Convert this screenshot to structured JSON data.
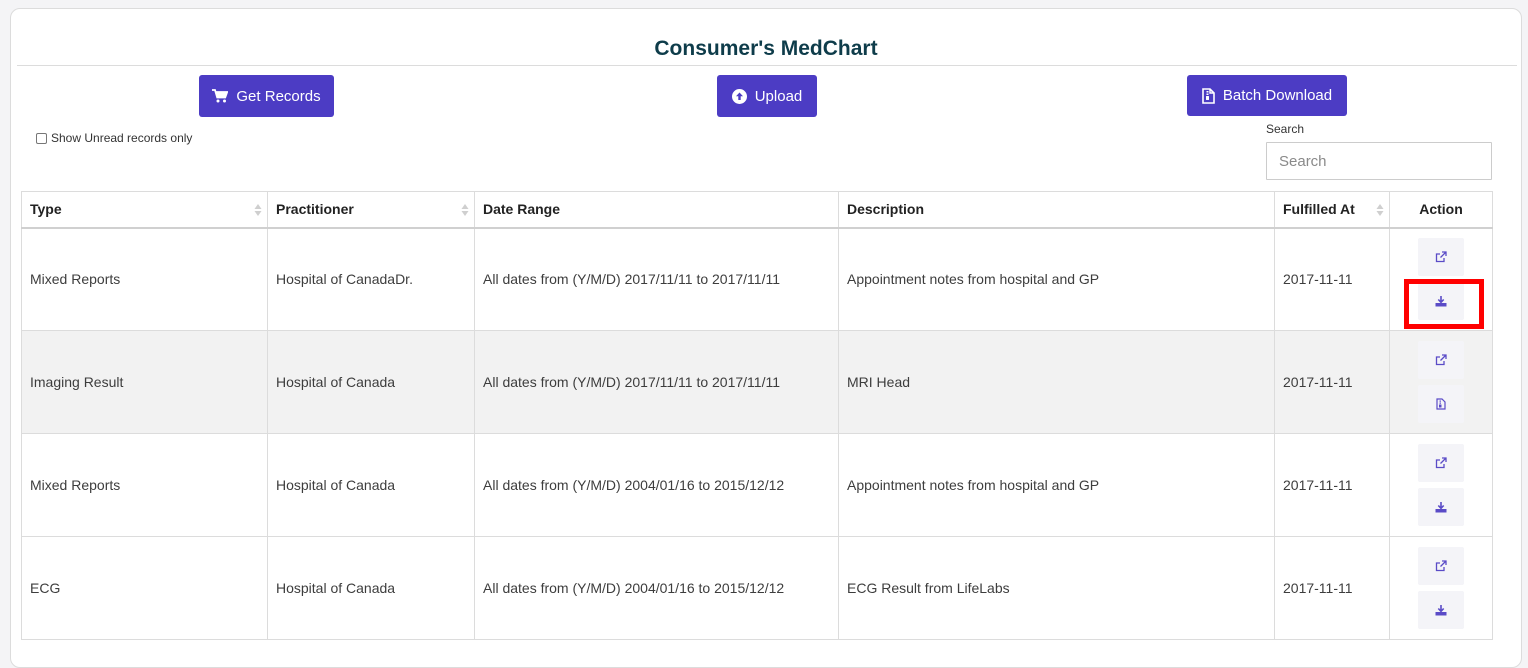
{
  "page": {
    "title": "Consumer's MedChart"
  },
  "toolbar": {
    "get_records": {
      "label": "Get Records",
      "icon": "shopping-cart-icon"
    },
    "upload": {
      "label": "Upload",
      "icon": "arrow-circle-up-icon"
    },
    "batch_download": {
      "label": "Batch Download",
      "icon": "file-zip-icon"
    }
  },
  "filter": {
    "show_unread_label": "Show Unread records only",
    "checked": false
  },
  "search": {
    "label": "Search",
    "placeholder": "Search",
    "value": ""
  },
  "table": {
    "headers": {
      "type": "Type",
      "practitioner": "Practitioner",
      "date_range": "Date Range",
      "description": "Description",
      "fulfilled_at": "Fulfilled At",
      "action": "Action"
    },
    "rows": [
      {
        "type": "Mixed Reports",
        "practitioner": "Hospital of CanadaDr.",
        "date_range": "All dates from (Y/M/D) 2017/11/11 to 2017/11/11",
        "description": "Appointment notes from hospital and GP",
        "fulfilled_at": "2017-11-11",
        "actions": [
          "external-link-icon",
          "download-icon"
        ]
      },
      {
        "type": "Imaging Result",
        "practitioner": "Hospital of Canada",
        "date_range": "All dates from (Y/M/D) 2017/11/11 to 2017/11/11",
        "description": "MRI Head",
        "fulfilled_at": "2017-11-11",
        "actions": [
          "external-link-icon",
          "file-zip-icon"
        ]
      },
      {
        "type": "Mixed Reports",
        "practitioner": "Hospital of Canada",
        "date_range": "All dates from (Y/M/D) 2004/01/16 to 2015/12/12",
        "description": "Appointment notes from hospital and GP",
        "fulfilled_at": "2017-11-11",
        "actions": [
          "external-link-icon",
          "download-icon"
        ]
      },
      {
        "type": "ECG",
        "practitioner": "Hospital of Canada",
        "date_range": "All dates from (Y/M/D) 2004/01/16 to 2015/12/12",
        "description": "ECG Result from LifeLabs",
        "fulfilled_at": "2017-11-11",
        "actions": [
          "external-link-icon",
          "download-icon"
        ]
      }
    ]
  },
  "colors": {
    "primary": "#4c3cc4",
    "title": "#0e3c4a",
    "highlight": "#ff0000",
    "icon": "#5a4bc7"
  }
}
